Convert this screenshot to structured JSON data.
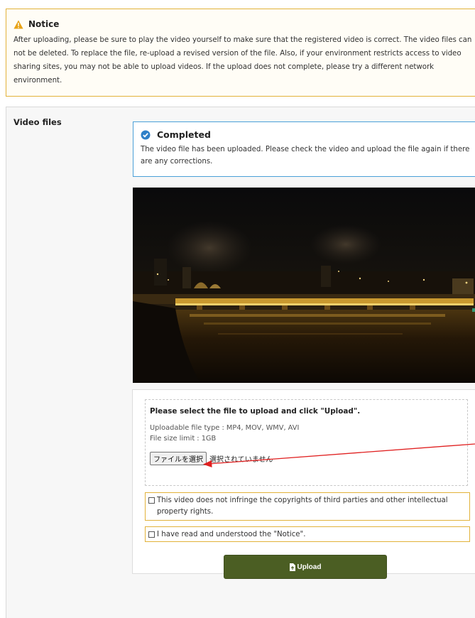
{
  "notice": {
    "title": "Notice",
    "body": "After uploading, please be sure to play the video yourself to make sure that the registered video is correct. The video files can not be deleted. To replace the file, re-upload a revised version of the file. Also, if your environment restricts access to video sharing sites, you may not be able to upload videos. If the upload does not complete, please try a different network environment."
  },
  "video_files": {
    "label": "Video files",
    "status_title": "Completed",
    "status_body": "The video file has been uploaded. Please check the video and upload the file again if there are any corrections."
  },
  "upload": {
    "instruction": "Please select the file to upload and click \"Upload\".",
    "file_types": "Uploadable file type : MP4, MOV, WMV, AVI",
    "size_limit": "File size limit : 1GB",
    "choose_button": "ファイルを選択",
    "no_file_text": "選択されていません",
    "checkbox_copyright": "This video does not infringe the copyrights of third parties and other intellectual property rights.",
    "checkbox_notice": "I have read and understood the \"Notice\".",
    "upload_button": "Upload"
  },
  "colors": {
    "notice_border": "#e2b23a",
    "status_border": "#4aa0d8",
    "upload_button_bg": "#4b5e23",
    "annotation_arrow": "#e02020"
  },
  "icons": {
    "notice": "warning-triangle-icon",
    "status": "check-circle-icon",
    "upload": "file-upload-icon"
  }
}
